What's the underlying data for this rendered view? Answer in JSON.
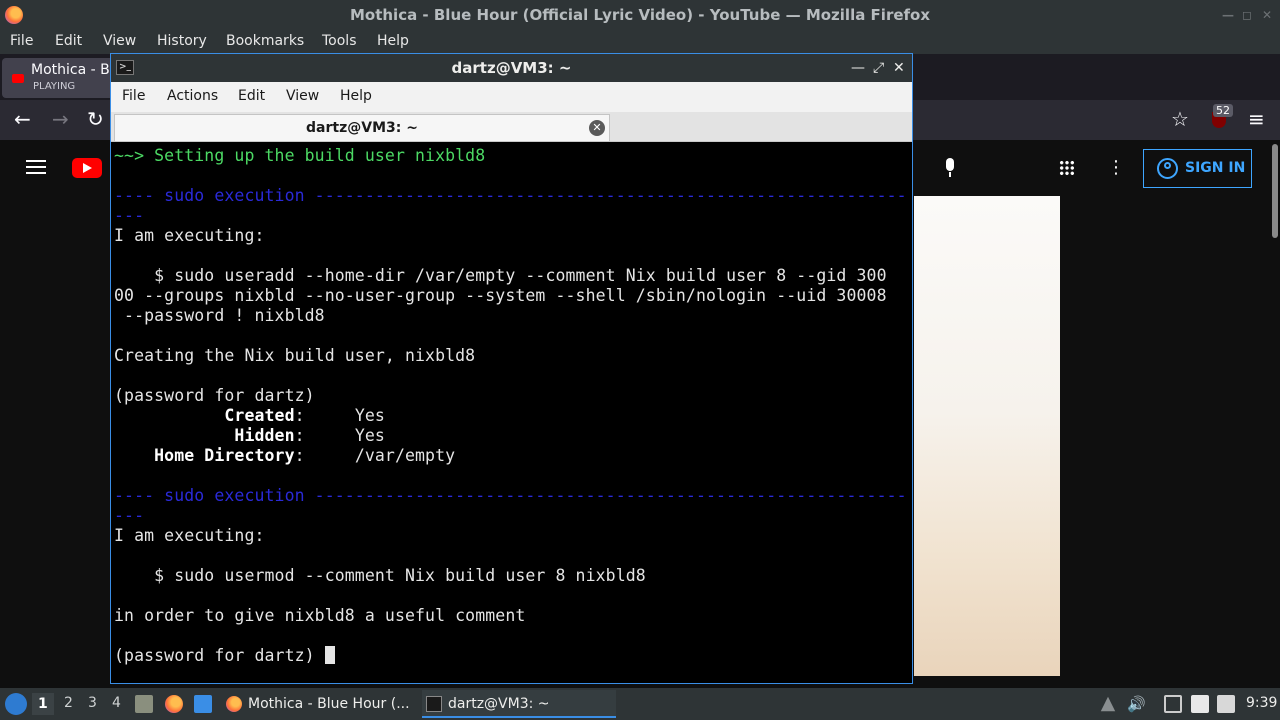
{
  "firefox": {
    "window_title": "Mothica - Blue Hour (Official Lyric Video) - YouTube — Mozilla Firefox",
    "menu": [
      "File",
      "Edit",
      "View",
      "History",
      "Bookmarks",
      "Tools",
      "Help"
    ],
    "tab": {
      "title": "Mothica - Bl",
      "status": "PLAYING"
    },
    "extension_badge": "52"
  },
  "youtube": {
    "signin_label": "SIGN IN",
    "logo_letter": "Y"
  },
  "terminal": {
    "title": "dartz@VM3: ~",
    "menu": [
      "File",
      "Actions",
      "Edit",
      "View",
      "Help"
    ],
    "tab_title": "dartz@VM3: ~",
    "lines": [
      {
        "text": "~~> Setting up the build user nixbld8",
        "style": "green"
      },
      {
        "text": "",
        "style": ""
      },
      {
        "text": "---- sudo execution ------------------------------------------------------------",
        "style": "blue"
      },
      {
        "text": "---",
        "style": "blue"
      },
      {
        "text": "I am executing:",
        "style": ""
      },
      {
        "text": "",
        "style": ""
      },
      {
        "text": "    $ sudo useradd --home-dir /var/empty --comment Nix build user 8 --gid 300",
        "style": ""
      },
      {
        "text": "00 --groups nixbld --no-user-group --system --shell /sbin/nologin --uid 30008",
        "style": ""
      },
      {
        "text": " --password ! nixbld8",
        "style": ""
      },
      {
        "text": "",
        "style": ""
      },
      {
        "text": "Creating the Nix build user, nixbld8",
        "style": ""
      },
      {
        "text": "",
        "style": ""
      },
      {
        "text": "(password for dartz)",
        "style": ""
      },
      {
        "label": "           Created",
        "value": "     Yes",
        "style": "kv"
      },
      {
        "label": "            Hidden",
        "value": "     Yes",
        "style": "kv"
      },
      {
        "label": "    Home Directory",
        "value": "     /var/empty",
        "style": "kv"
      },
      {
        "text": "",
        "style": ""
      },
      {
        "text": "---- sudo execution ------------------------------------------------------------",
        "style": "blue"
      },
      {
        "text": "---",
        "style": "blue"
      },
      {
        "text": "I am executing:",
        "style": ""
      },
      {
        "text": "",
        "style": ""
      },
      {
        "text": "    $ sudo usermod --comment Nix build user 8 nixbld8",
        "style": ""
      },
      {
        "text": "",
        "style": ""
      },
      {
        "text": "in order to give nixbld8 a useful comment",
        "style": ""
      },
      {
        "text": "",
        "style": ""
      },
      {
        "text": "(password for dartz) ",
        "style": "prompt"
      }
    ]
  },
  "taskbar": {
    "workspaces": [
      "1",
      "2",
      "3",
      "4"
    ],
    "tasks": [
      {
        "label": "Mothica - Blue Hour (..."
      },
      {
        "label": "dartz@VM3: ~"
      }
    ],
    "clock": "9:39"
  }
}
